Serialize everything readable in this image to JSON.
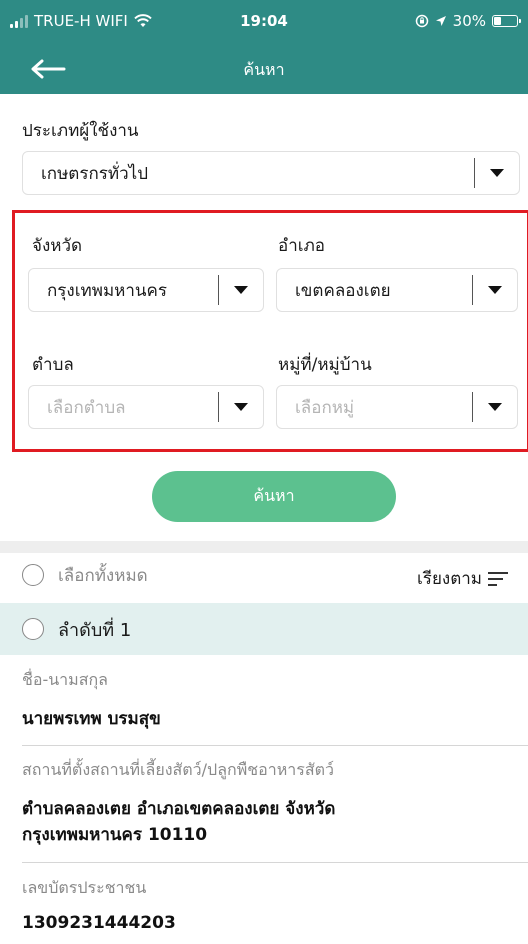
{
  "status_bar": {
    "carrier": "TRUE-H WIFI",
    "time": "19:04",
    "battery_percent": "30%",
    "battery_level": 0.3,
    "icons": [
      "signal-icon",
      "wifi-icon",
      "rotation-lock-icon",
      "location-icon",
      "battery-icon"
    ]
  },
  "nav": {
    "title": "ค้นหา",
    "back_icon": "arrow-left-icon"
  },
  "form": {
    "user_type_label": "ประเภทผู้ใช้งาน",
    "user_type_value": "เกษตรกรทั่วไป",
    "province_label": "จังหวัด",
    "province_value": "กรุงเทพมหานคร",
    "district_label": "อำเภอ",
    "district_value": "เขตคลองเตย",
    "subdistrict_label": "ตำบล",
    "subdistrict_placeholder": "เลือกตำบล",
    "village_label": "หมู่ที่/หมู่บ้าน",
    "village_placeholder": "เลือกหมู่",
    "search_button": "ค้นหา"
  },
  "results": {
    "select_all_label": "เลือกทั้งหมด",
    "sort_label": "เรียงตาม",
    "record": {
      "title": "ลำดับที่ 1",
      "name_label": "ชื่อ-นามสกุล",
      "name_value": "นายพรเทพ บรมสุข",
      "location_label": "สถานที่ตั้งสถานที่เลี้ยงสัตว์/ปลูกพืชอาหารสัตว์",
      "location_line1": "ตำบลคลองเตย อำเภอเขตคลองเตย จังหวัด",
      "location_line2": "กรุงเทพมหานคร 10110",
      "id_label": "เลขบัตรประชาชน",
      "id_value": "1309231444203"
    }
  },
  "colors": {
    "header": "#2e8b85",
    "search_button": "#5cc18f",
    "highlight_box": "#e01b22",
    "record_header": "#e2f0ef"
  }
}
